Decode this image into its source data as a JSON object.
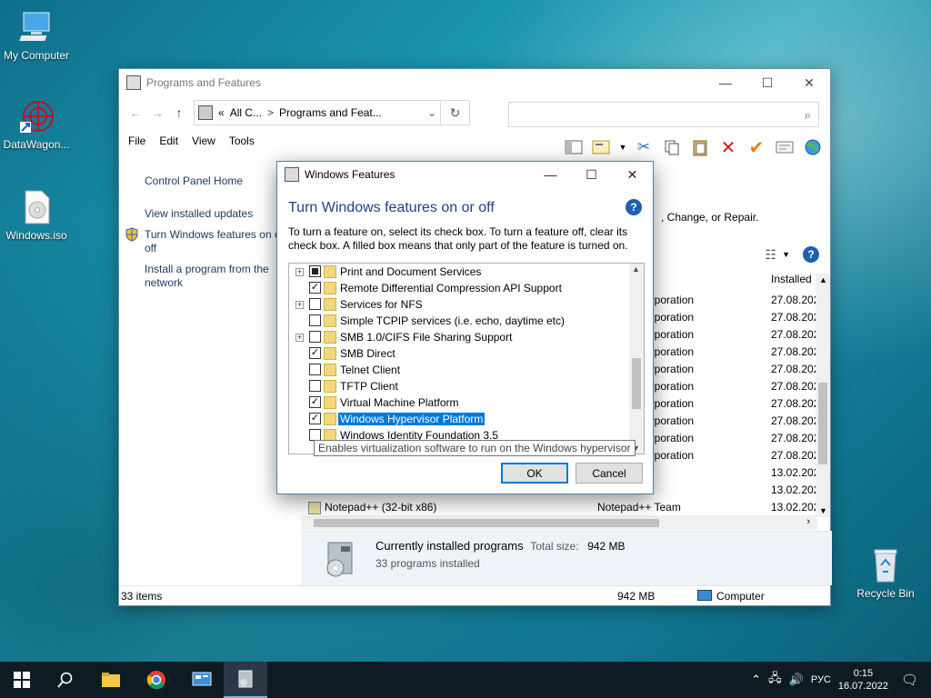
{
  "desktop": {
    "icons": [
      {
        "label": "My Computer"
      },
      {
        "label": "DataWagon..."
      },
      {
        "label": "Windows.iso"
      },
      {
        "label": "Recycle Bin"
      }
    ]
  },
  "explorer": {
    "title": "Programs and Features",
    "controls": {
      "minimize": "—",
      "maximize": "☐",
      "close": "✕"
    },
    "nav": {
      "back": "←",
      "forward": "→",
      "up": "↑",
      "refresh": "↻"
    },
    "address": {
      "segment1": "All C...",
      "separator": ">",
      "segment2": "Programs and Feat...",
      "dropdown": "⌄",
      "prefix": "«"
    },
    "search": {
      "value": "",
      "icon": "⌕"
    },
    "menu": [
      "File",
      "Edit",
      "View",
      "Tools"
    ],
    "sidebar": {
      "home": "Control Panel Home",
      "updates": "View installed updates",
      "features_line1": "Turn Windows features on or",
      "features_line2": "off",
      "install_line1": "Install a program from the",
      "install_line2": "network"
    },
    "right_header": ", Change, or Repair.",
    "columns": {
      "installed": "Installed"
    },
    "rows": [
      {
        "publisher": "orporation",
        "date": "27.08.202"
      },
      {
        "publisher": "orporation",
        "date": "27.08.202"
      },
      {
        "publisher": "orporation",
        "date": "27.08.202"
      },
      {
        "publisher": "orporation",
        "date": "27.08.202"
      },
      {
        "publisher": "orporation",
        "date": "27.08.202"
      },
      {
        "publisher": "orporation",
        "date": "27.08.202"
      },
      {
        "publisher": "orporation",
        "date": "27.08.202"
      },
      {
        "publisher": "orporation",
        "date": "27.08.202"
      },
      {
        "publisher": "orporation",
        "date": "27.08.202"
      },
      {
        "publisher": "orporation",
        "date": "27.08.202"
      },
      {
        "publisher": "",
        "date": "13.02.202"
      },
      {
        "publisher": "",
        "date": "13.02.202"
      },
      {
        "name": "Notepad++ (32-bit x86)",
        "publisher": "Notepad++ Team",
        "date": "13.02.202"
      }
    ],
    "details": {
      "title": "Currently installed programs",
      "size_label": "Total size:",
      "size_value": "942 MB",
      "count": "33 programs installed"
    },
    "status": {
      "items": "33 items",
      "size": "942 MB",
      "location": "Computer"
    }
  },
  "dialog": {
    "title": "Windows Features",
    "controls": {
      "minimize": "—",
      "maximize": "☐",
      "close": "✕"
    },
    "heading": "Turn Windows features on or off",
    "help": "?",
    "description": "To turn a feature on, select its check box. To turn a feature off, clear its check box. A filled box means that only part of the feature is turned on.",
    "features": [
      {
        "label": "Print and Document Services",
        "state": "partial",
        "expandable": true
      },
      {
        "label": "Remote Differential Compression API Support",
        "state": "checked",
        "expandable": false
      },
      {
        "label": "Services for NFS",
        "state": "unchecked",
        "expandable": true
      },
      {
        "label": "Simple TCPIP services (i.e. echo, daytime etc)",
        "state": "unchecked",
        "expandable": false
      },
      {
        "label": "SMB 1.0/CIFS File Sharing Support",
        "state": "unchecked",
        "expandable": true
      },
      {
        "label": "SMB Direct",
        "state": "checked",
        "expandable": false
      },
      {
        "label": "Telnet Client",
        "state": "unchecked",
        "expandable": false
      },
      {
        "label": "TFTP Client",
        "state": "unchecked",
        "expandable": false
      },
      {
        "label": "Virtual Machine Platform",
        "state": "checked",
        "expandable": false
      },
      {
        "label": "Windows Hypervisor Platform",
        "state": "checked",
        "expandable": false,
        "selected": true
      },
      {
        "label": "Windows Identity Foundation 3.5",
        "state": "unchecked",
        "expandable": false
      }
    ],
    "tooltip": "Enables virtualization software to run on the Windows hypervisor",
    "ok": "OK",
    "cancel": "Cancel"
  },
  "taskbar": {
    "language": "РУС",
    "time": "0:15",
    "date": "16.07.2022"
  },
  "colors": {
    "accent": "#0078d7",
    "heading": "#1f3f8a",
    "link": "#1e3a64"
  }
}
